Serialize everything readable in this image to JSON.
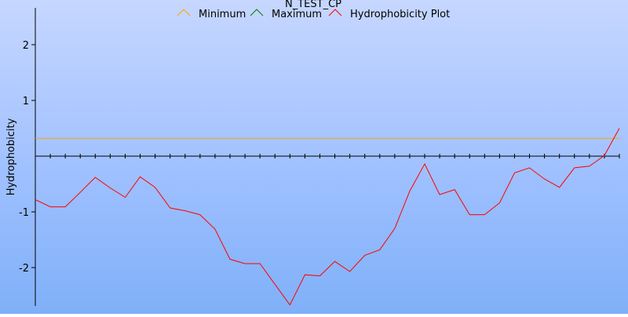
{
  "chart_data": {
    "type": "line",
    "title": "N_TEST_CP",
    "ylabel": "Hydrophobicity",
    "xlabel": "",
    "ylim": [
      -2.7,
      2.7
    ],
    "xlim": [
      0,
      39
    ],
    "yticks": [
      -2,
      -1,
      1,
      2
    ],
    "grid": false,
    "legend_position": "top-center",
    "legend": [
      {
        "name": "Minimum",
        "color": "#ffa500"
      },
      {
        "name": "Maximum",
        "color": "#008000"
      },
      {
        "name": "Hydrophobicity Plot",
        "color": "#ff0000"
      }
    ],
    "series": [
      {
        "name": "Minimum",
        "color": "#ffa500",
        "x": [
          0,
          39
        ],
        "values": [
          0.32,
          0.32
        ]
      },
      {
        "name": "Hydrophobicity Plot",
        "color": "#ff0000",
        "x": [
          0,
          1,
          2,
          3,
          4,
          5,
          6,
          7,
          8,
          9,
          10,
          11,
          12,
          13,
          14,
          15,
          16,
          17,
          18,
          19,
          20,
          21,
          22,
          23,
          24,
          25,
          26,
          27,
          28,
          29,
          30,
          31,
          32,
          33,
          34,
          35,
          36,
          37,
          38,
          39
        ],
        "values": [
          -0.78,
          -0.91,
          -0.91,
          -0.65,
          -0.38,
          -0.57,
          -0.74,
          -0.37,
          -0.56,
          -0.93,
          -0.98,
          -1.05,
          -1.31,
          -1.85,
          -1.93,
          -1.93,
          -2.3,
          -2.67,
          -2.13,
          -2.15,
          -1.89,
          -2.07,
          -1.78,
          -1.68,
          -1.3,
          -0.63,
          -0.14,
          -0.69,
          -0.6,
          -1.05,
          -1.05,
          -0.84,
          -0.3,
          -0.21,
          -0.41,
          -0.56,
          -0.21,
          -0.18,
          0.01,
          0.5
        ]
      }
    ]
  }
}
